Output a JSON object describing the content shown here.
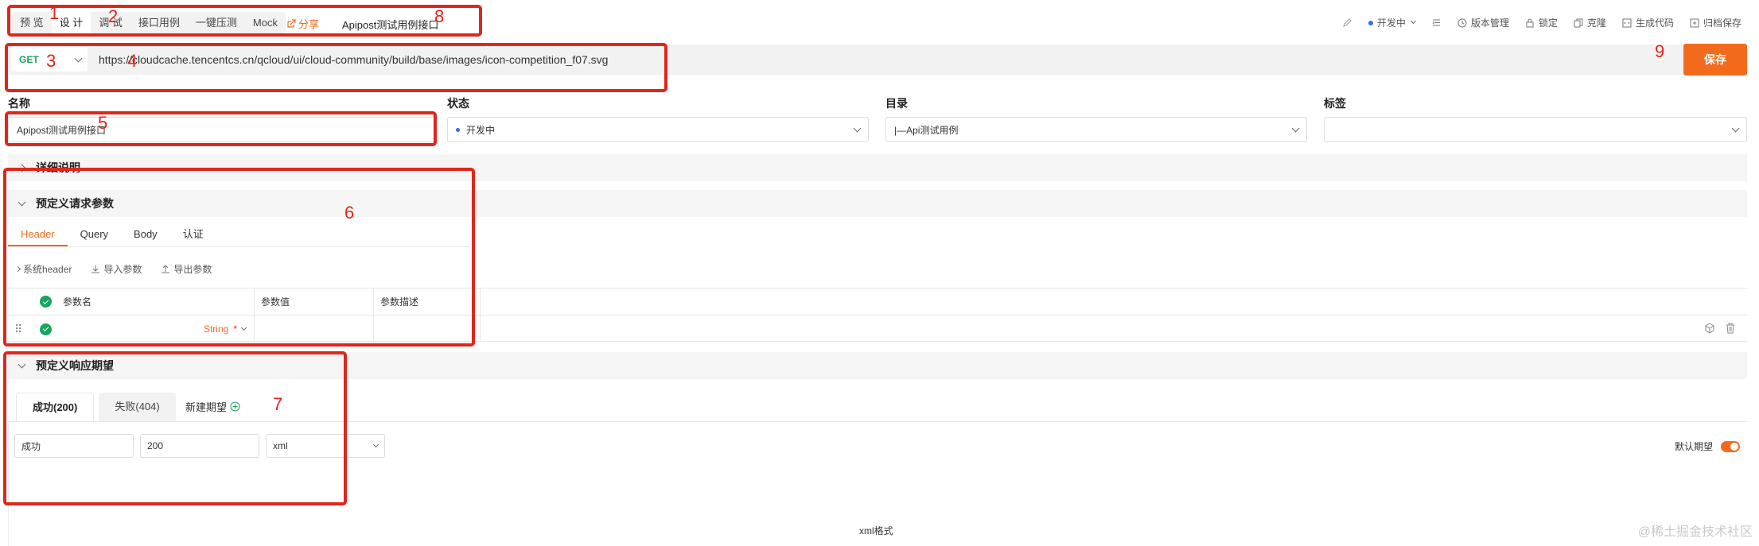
{
  "mode_tabs": [
    "预 览",
    "设 计",
    "调 试",
    "接口用例",
    "一键压测",
    "Mock"
  ],
  "share_label": "分享",
  "api_title": "Apipost测试用例接口",
  "toolbar": {
    "status": "开发中",
    "version": "版本管理",
    "lock": "锁定",
    "clone": "克隆",
    "gen_code": "生成代码",
    "archive": "归档保存"
  },
  "request": {
    "method": "GET",
    "url": "https://cloudcache.tencentcs.cn/qcloud/ui/cloud-community/build/base/images/icon-competition_f07.svg"
  },
  "save_label": "保存",
  "fields": {
    "name_label": "名称",
    "name_value": "Apipost测试用例接口",
    "status_label": "状态",
    "status_value": "开发中",
    "dir_label": "目录",
    "dir_value": "|—Api测试用例",
    "tag_label": "标签",
    "tag_value": ""
  },
  "sections": {
    "detail": "详细说明",
    "predefined_params": "预定义请求参数",
    "predefined_response": "预定义响应期望"
  },
  "param_tabs": [
    "Header",
    "Query",
    "Body",
    "认证"
  ],
  "param_actions": {
    "system_header": "系统header",
    "import": "导入参数",
    "export": "导出参数"
  },
  "param_columns": [
    "参数名",
    "参数值",
    "参数描述"
  ],
  "param_row": {
    "type": "String",
    "required_mark": "*"
  },
  "response_tabs": [
    "成功(200)",
    "失败(404)"
  ],
  "new_expect": "新建期望",
  "response_fields": {
    "name": "成功",
    "code": "200",
    "format": "xml"
  },
  "default_expect": "默认期望",
  "xml_format": "xml格式",
  "annotations": [
    "1",
    "2",
    "3",
    "4",
    "5",
    "6",
    "7",
    "8",
    "9"
  ],
  "watermark": "@稀土掘金技术社区",
  "colors": {
    "accent": "#f26b1d",
    "success": "#1aa35c",
    "annotation": "#e1251b",
    "status_dot": "#2f6ff5"
  }
}
